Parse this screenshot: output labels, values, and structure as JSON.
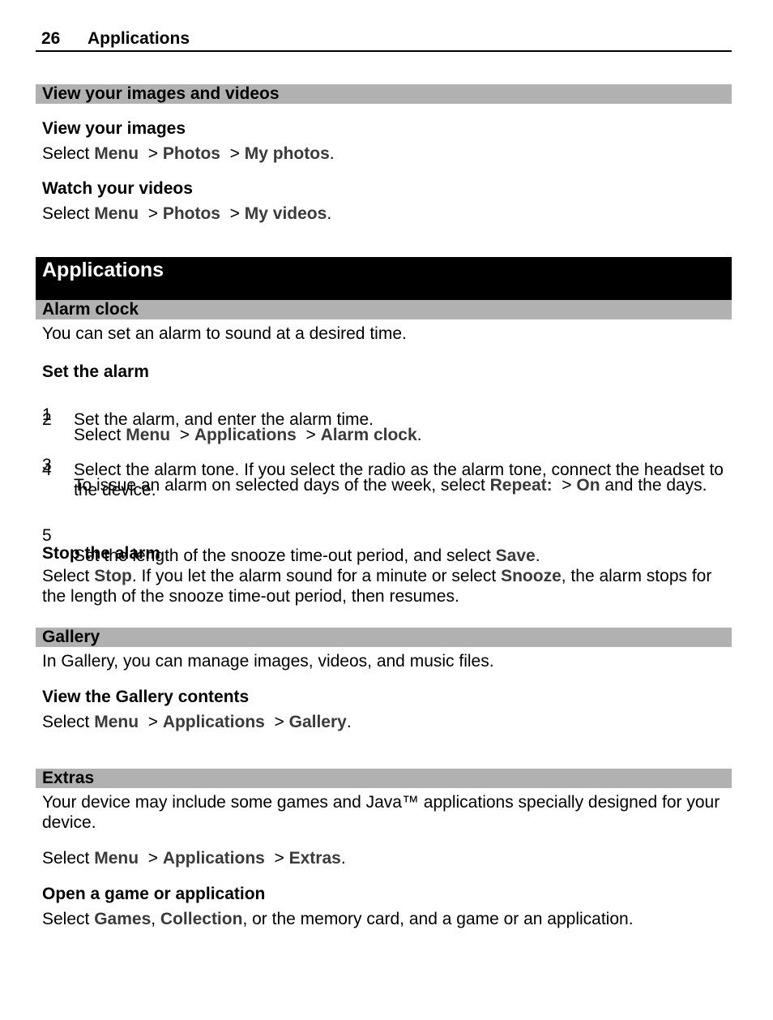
{
  "header": {
    "page_number": "26",
    "section": "Applications"
  },
  "view_images_videos": {
    "title": "View your images and videos",
    "view_images": {
      "heading": "View your images",
      "select": "Select ",
      "menu": "Menu",
      "sep1": "  > ",
      "photos": "Photos",
      "sep2": "  > ",
      "target": "My photos",
      "end": "."
    },
    "watch_videos": {
      "heading": "Watch your videos",
      "select": "Select ",
      "menu": "Menu",
      "sep1": "  > ",
      "photos": "Photos",
      "sep2": "  > ",
      "target": "My videos",
      "end": "."
    }
  },
  "chapter": {
    "title": "Applications"
  },
  "alarm_clock": {
    "title": "Alarm clock",
    "intro": "You can set an alarm to sound at a desired time.",
    "set_heading": "Set the alarm",
    "steps": [
      {
        "num": "1",
        "pre": "Select ",
        "b1": "Menu",
        "s1": "  > ",
        "b2": "Applications",
        "s2": "  > ",
        "b3": "Alarm clock",
        "post": "."
      },
      {
        "num": "2",
        "text": "Set the alarm, and enter the alarm time."
      },
      {
        "num": "3",
        "pre": "To issue an alarm on selected days of the week, select ",
        "b1": "Repeat:",
        "s1": "  > ",
        "b2": "On",
        "post": " and the days."
      },
      {
        "num": "4",
        "text": "Select the alarm tone. If you select the radio as the alarm tone, connect the headset to the device."
      },
      {
        "num": "5",
        "pre": "Set the length of the snooze time-out period, and select ",
        "b1": "Save",
        "post": "."
      }
    ],
    "stop_heading": "Stop the alarm",
    "stop": {
      "pre": "Select ",
      "b1": "Stop",
      "mid": ". If you let the alarm sound for a minute or select ",
      "b2": "Snooze",
      "post": ", the alarm stops for the length of the snooze time-out period, then resumes."
    }
  },
  "gallery": {
    "title": "Gallery",
    "intro": "In Gallery, you can manage images, videos, and music files.",
    "view_heading": "View the Gallery contents",
    "select": "Select ",
    "menu": "Menu",
    "sep1": "  > ",
    "apps": "Applications",
    "sep2": "  > ",
    "target": "Gallery",
    "end": "."
  },
  "extras": {
    "title": "Extras",
    "intro": "Your device may include some games and Java™ applications specially designed for your device.",
    "select": "Select ",
    "menu": "Menu",
    "sep1": "  > ",
    "apps": "Applications",
    "sep2": "  > ",
    "target": "Extras",
    "end": ".",
    "open_heading": "Open a game or application",
    "open": {
      "pre": "Select ",
      "b1": "Games",
      "mid": ", ",
      "b2": "Collection",
      "post": ", or the memory card, and a game or an application."
    }
  }
}
